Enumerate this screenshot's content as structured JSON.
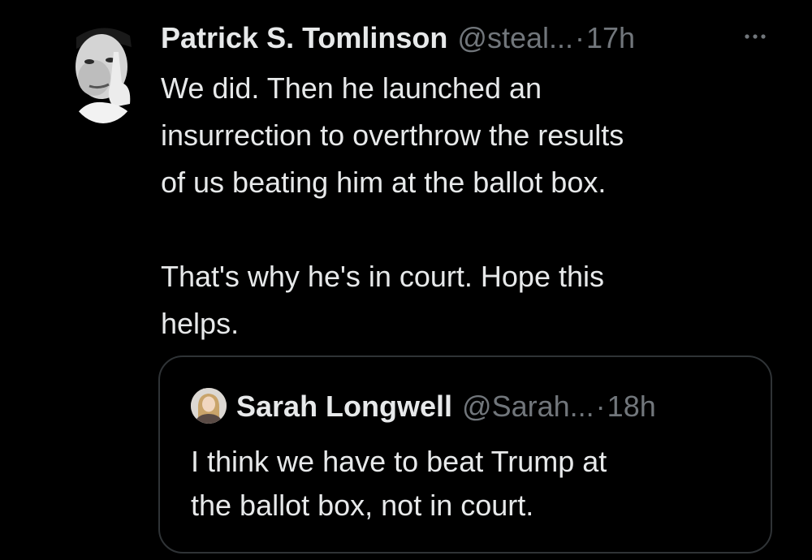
{
  "tweet": {
    "author": {
      "display_name": "Patrick S. Tomlinson",
      "handle": "@steal...",
      "avatar_icon": "user-avatar"
    },
    "separator": "·",
    "timestamp": "17h",
    "more_icon": "more-horizontal-icon",
    "text": "We did. Then he launched an\ninsurrection to overthrow the results\nof us beating him at the ballot box.\n\nThat's why he's in court. Hope this\nhelps."
  },
  "quoted_tweet": {
    "author": {
      "display_name": "Sarah Longwell",
      "handle": "@Sarah...",
      "avatar_icon": "user-avatar"
    },
    "separator": "·",
    "timestamp": "18h",
    "text_lines": [
      "I think we have to beat Trump at",
      "the ballot box, not in court."
    ]
  },
  "colors": {
    "background": "#000000",
    "primary_text": "#e7e9ea",
    "secondary_text": "#71767b",
    "border": "#2f3336"
  }
}
